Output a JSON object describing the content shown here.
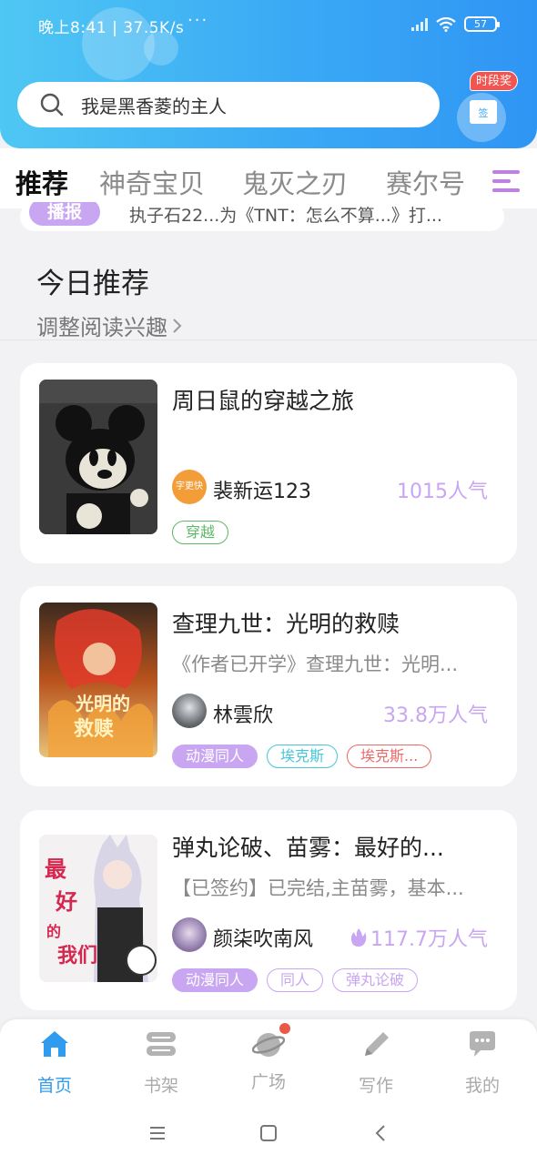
{
  "status_bar": {
    "time_speed": "晚上8:41 | 37.5K/s",
    "dots": "···",
    "battery": "57"
  },
  "search": {
    "placeholder": "我是黑香菱的主人"
  },
  "checkin": {
    "badge": "时段奖",
    "icon_label": "签"
  },
  "tabs": [
    {
      "label": "推荐",
      "active": true
    },
    {
      "label": "神奇宝贝",
      "active": false
    },
    {
      "label": "鬼灭之刃",
      "active": false
    },
    {
      "label": "赛尔号",
      "active": false
    }
  ],
  "broadcast": {
    "tag": "播报",
    "text": "执子石22...为《TNT：怎么不算...》打..."
  },
  "section": {
    "title": "今日推荐",
    "link": "调整阅读兴趣"
  },
  "books": [
    {
      "title": "周日鼠的穿越之旅",
      "desc": "",
      "author": "裴新运123",
      "author_avatar_text": "字更快",
      "popularity": "1015人气",
      "hot": false,
      "tags": [
        {
          "label": "穿越",
          "color": "#5fb86a"
        }
      ]
    },
    {
      "title": "查理九世：光明的救赎",
      "desc": "《作者已开学》查理九世：光明...",
      "author": "林雲欣",
      "popularity": "33.8万人气",
      "hot": false,
      "tags": [
        {
          "label": "动漫同人",
          "color": "#c9a6f2",
          "filled": true
        },
        {
          "label": "埃克斯",
          "color": "#45c6d9"
        },
        {
          "label": "埃克斯...",
          "color": "#e96a6a"
        }
      ]
    },
    {
      "title": "弹丸论破、苗雾：最好的...",
      "desc": "【已签约】已完结,主苗雾，基本...",
      "author": "颜柒吹南风",
      "popularity": "117.7万人气",
      "hot": true,
      "tags": [
        {
          "label": "动漫同人",
          "color": "#c9a6f2",
          "filled": true
        },
        {
          "label": "同人",
          "color": "#c9a6f2"
        },
        {
          "label": "弹丸论破",
          "color": "#c9a6f2"
        }
      ]
    }
  ],
  "bottom_nav": [
    {
      "label": "首页",
      "icon": "home-icon",
      "active": true
    },
    {
      "label": "书架",
      "icon": "bookshelf-icon",
      "active": false
    },
    {
      "label": "广场",
      "icon": "planet-icon",
      "active": false,
      "dot": true
    },
    {
      "label": "写作",
      "icon": "pen-icon",
      "active": false
    },
    {
      "label": "我的",
      "icon": "chat-bubble-icon",
      "active": false
    }
  ],
  "colors": {
    "header_gradient": [
      "#4fc7f3",
      "#2f95f4"
    ],
    "accent_purple": "#c9a6f2",
    "active_blue": "#2f9cf0"
  }
}
